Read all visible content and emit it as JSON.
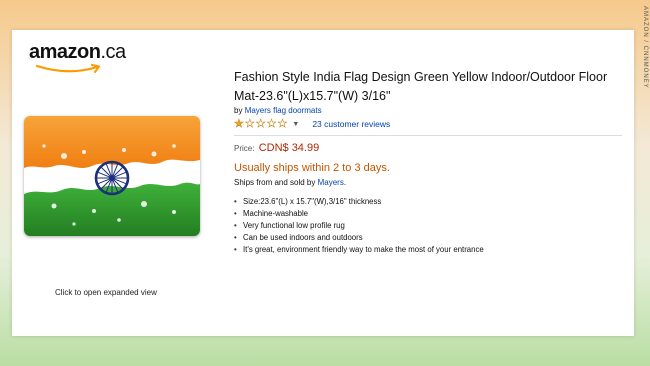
{
  "watermark": "AMAZON / CNNMONEY",
  "logo": {
    "text": "amazon",
    "tld": ".ca"
  },
  "product": {
    "title": "Fashion Style India Flag Design Green Yellow Indoor/Outdoor Floor Mat-23.6\"(L)x15.7\"(W) 3/16\"",
    "by_label": "by",
    "brand": "Mayers flag doormats",
    "rating": {
      "filled_stars": 1,
      "max_stars": 5,
      "reviews_text": "23 customer reviews"
    },
    "price_label": "Price:",
    "price": "CDN$ 34.99",
    "availability": "Usually ships within 2 to 3 days.",
    "sold_by_prefix": "Ships from and sold by ",
    "sold_by_seller": "Mayers",
    "sold_by_suffix": ".",
    "features": [
      "Size:23.6\"(L) x 15.7\"(W),3/16\" thickness",
      "Machine-washable",
      "Very functional low profile rug",
      "Can be used indoors and outdoors",
      "It's great, environment friendly way to make the most of your entrance"
    ]
  },
  "image": {
    "expand_text": "Click to open expanded view"
  },
  "colors": {
    "saffron": "#f28a1c",
    "green": "#2f9a2d",
    "chakra_blue": "#1c2f7a",
    "price_red": "#b12704",
    "availability_orange": "#c45500",
    "link_blue": "#0645ad"
  },
  "icons": {
    "rating_dropdown": "caret-down-icon",
    "bullet": "bullet-icon"
  }
}
